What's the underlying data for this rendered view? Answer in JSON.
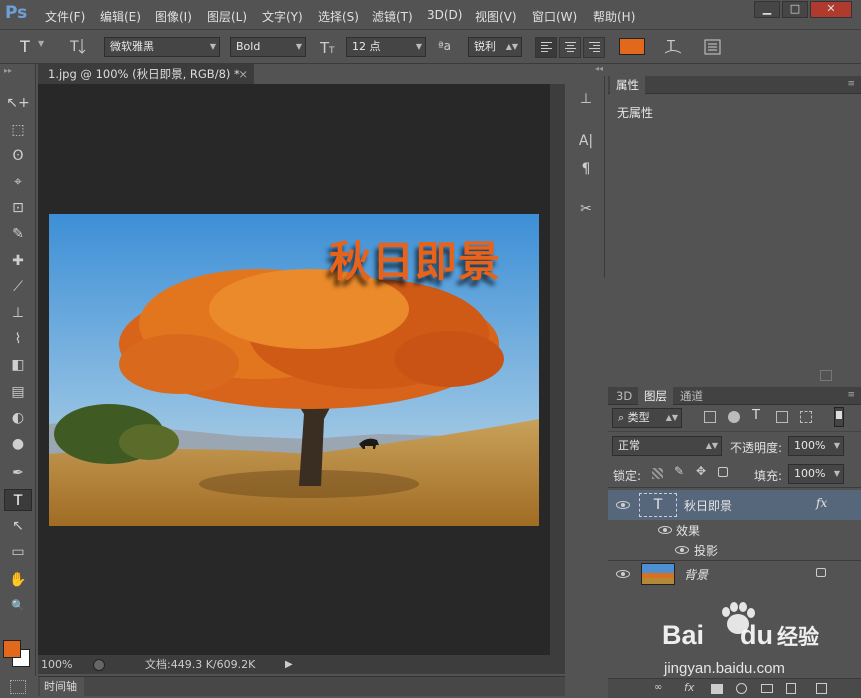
{
  "app": {
    "logo": "Ps"
  },
  "menu": [
    "文件(F)",
    "编辑(E)",
    "图像(I)",
    "图层(L)",
    "文字(Y)",
    "选择(S)",
    "滤镜(T)",
    "3D(D)",
    "视图(V)",
    "窗口(W)",
    "帮助(H)"
  ],
  "window_controls": {
    "minimize": "▁",
    "maximize": "□",
    "close": "✕"
  },
  "options": {
    "tool_glyph": "T",
    "font_family": "微软雅黑",
    "font_style": "Bold",
    "font_size": "12 点",
    "aa_label": "ªa",
    "antialias": "锐利",
    "text_color": "#e2691c"
  },
  "document": {
    "tab_title": "1.jpg @ 100% (秋日即景, RGB/8) *",
    "tab_close": "×",
    "overlay_text": "秋日即景",
    "overlay_color": "#e8621a"
  },
  "status": {
    "zoom": "100%",
    "doc_info": "文档:449.3 K/609.2K"
  },
  "timeline": {
    "label": "时间轴"
  },
  "tools": [
    "↖+",
    "⬚",
    "ʘ",
    "⌖",
    "⊡",
    "✎",
    "✚",
    "⟋",
    "⊥",
    "⌇",
    "◧",
    "▤",
    "◐",
    "●",
    "✒",
    "T",
    "↖",
    "▭",
    "✋",
    "🔍"
  ],
  "colors": {
    "foreground": "#e2691c",
    "background": "#ffffff"
  },
  "properties": {
    "tab": "属性",
    "content": "无属性"
  },
  "layers": {
    "tabs": [
      "3D",
      "图层",
      "通道"
    ],
    "active_tab": "图层",
    "filter_kind": "类型",
    "blend_mode": "正常",
    "opacity_label": "不透明度:",
    "opacity": "100%",
    "lock_label": "锁定:",
    "fill_label": "填充:",
    "fill": "100%",
    "items": [
      {
        "name": "秋日即景",
        "kind": "text",
        "fx": "fx"
      },
      {
        "name": "效果",
        "kind": "effects"
      },
      {
        "name": "投影",
        "kind": "effect"
      },
      {
        "name": "背景",
        "kind": "image",
        "locked": true
      }
    ]
  },
  "watermark": {
    "brand": "Bai",
    "brand2": "du",
    "suffix": "经验",
    "url": "jingyan.baidu.com"
  }
}
